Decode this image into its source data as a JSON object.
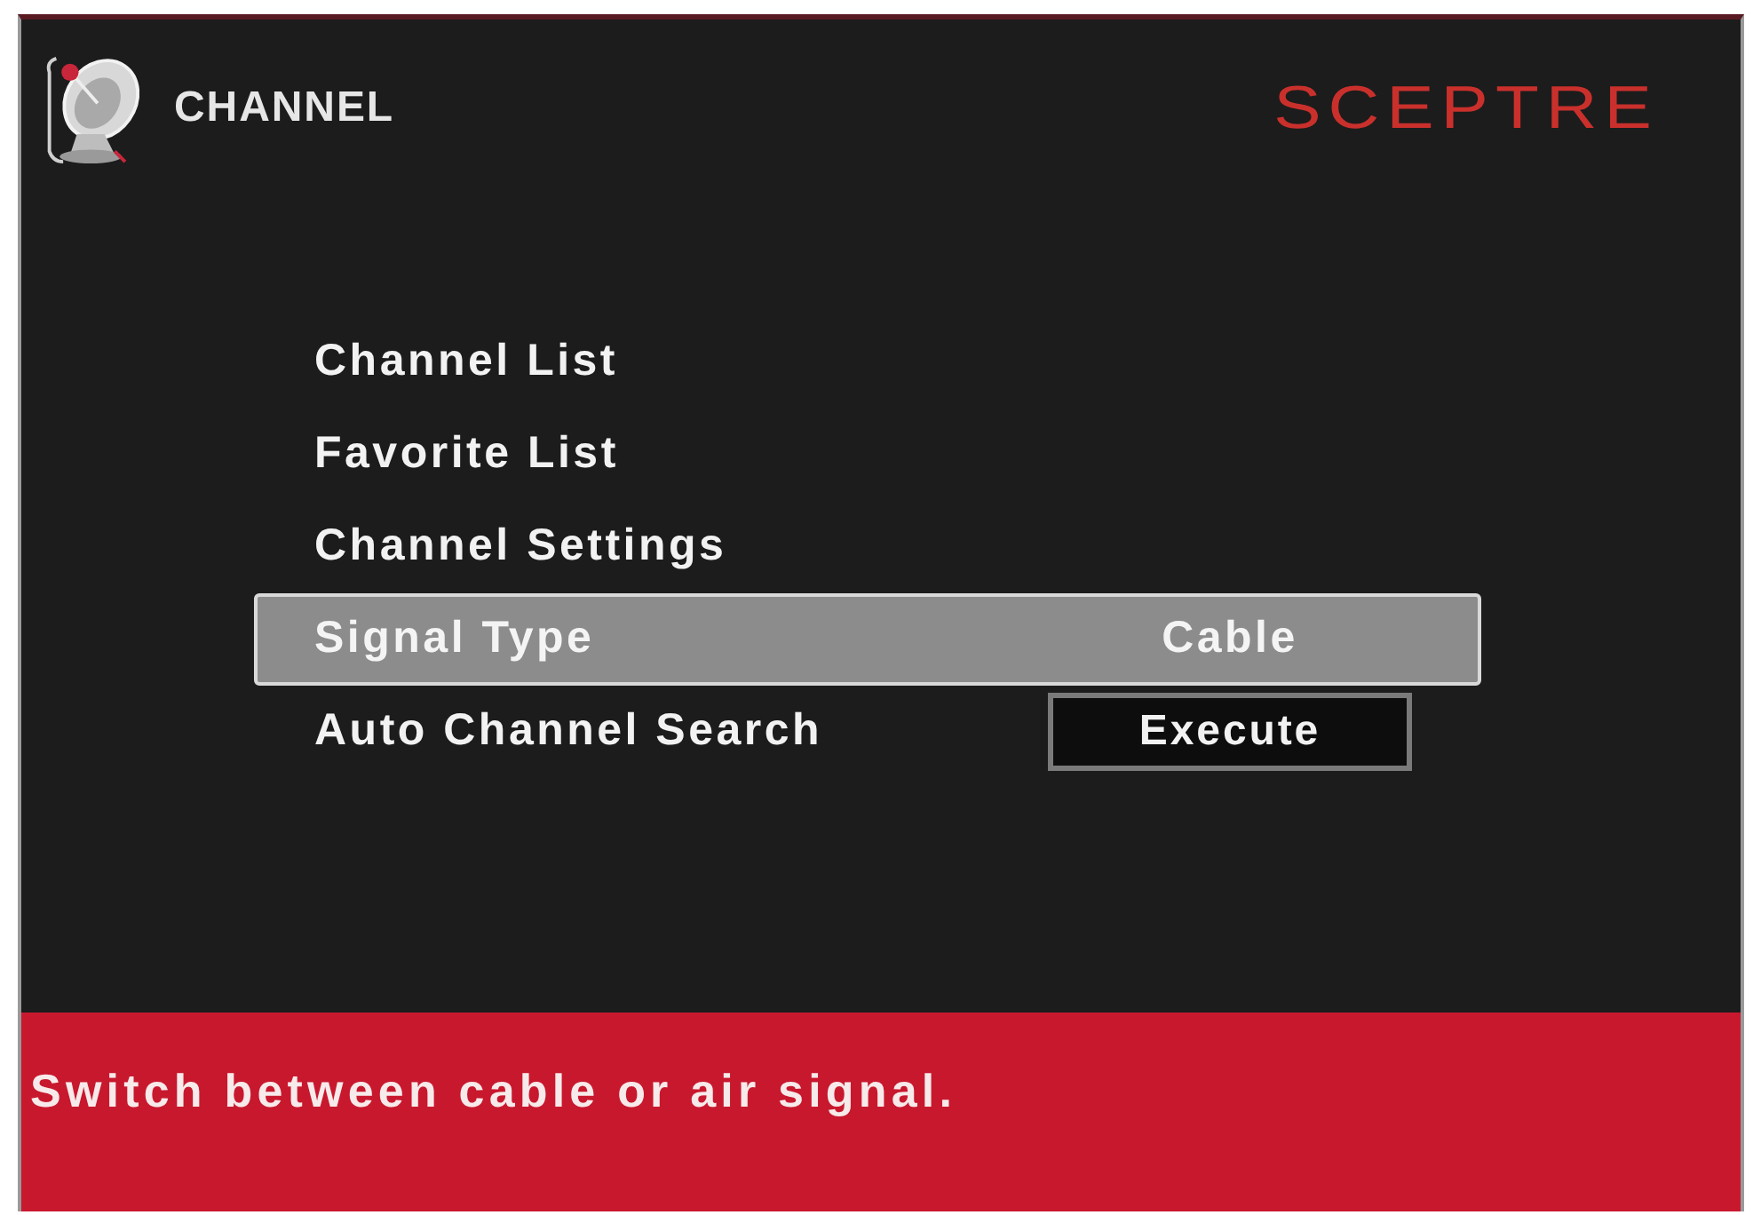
{
  "header": {
    "title": "CHANNEL",
    "logo": "SCEPTRE"
  },
  "menu": [
    {
      "kind": "submenu",
      "label": "Channel List",
      "selected": false
    },
    {
      "kind": "submenu",
      "label": "Favorite List",
      "selected": false
    },
    {
      "kind": "submenu",
      "label": "Channel Settings",
      "selected": false
    },
    {
      "kind": "option",
      "label": "Signal Type",
      "value": "Cable",
      "selected": true
    },
    {
      "kind": "action",
      "label": "Auto Channel Search",
      "action": "Execute",
      "selected": false
    }
  ],
  "help": "Switch between cable or air signal."
}
